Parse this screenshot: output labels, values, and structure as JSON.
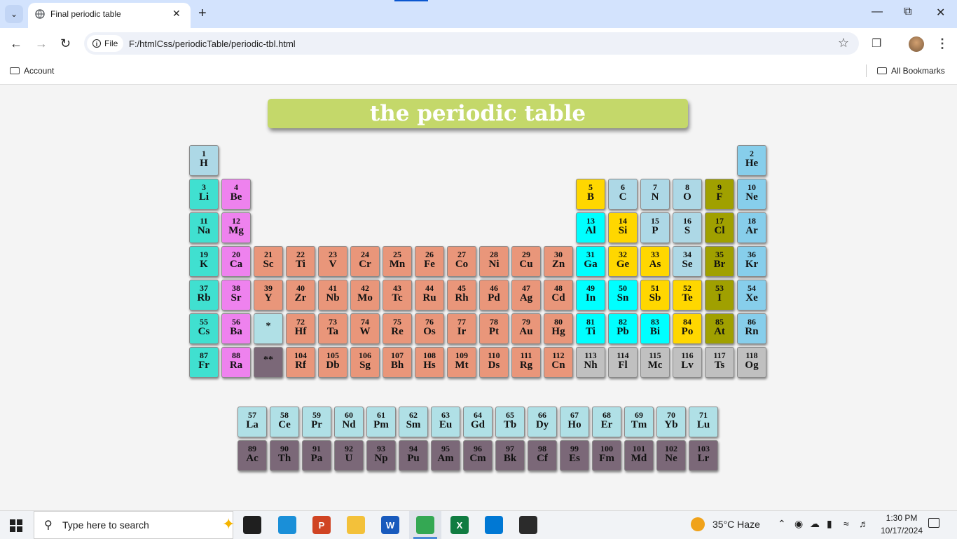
{
  "browser": {
    "tab_title": "Final periodic table",
    "url_chip": "File",
    "url": "F:/htmlCss/periodicTable/periodic-tbl.html",
    "bookmark_left": "Account",
    "bookmark_right": "All Bookmarks"
  },
  "page": {
    "title": "the periodic table",
    "colors": {
      "alkali": "#40e0d0",
      "alkaline": "#ee82ee",
      "transition": "#e9967a",
      "metalloid": "#ffd700",
      "post_transition": "#00ffff",
      "nonmetal": "#add8e6",
      "halogen": "#a0a000",
      "noble": "#87ceeb",
      "unknown": "#c0c0c0",
      "lanthanide": "#b0e0e6",
      "actinide": "#7b6878"
    },
    "elements": [
      {
        "n": "1",
        "s": "H",
        "row": 1,
        "col": 1,
        "c": "nonmetal"
      },
      {
        "n": "2",
        "s": "He",
        "row": 1,
        "col": 18,
        "c": "noble"
      },
      {
        "n": "3",
        "s": "Li",
        "row": 2,
        "col": 1,
        "c": "alkali"
      },
      {
        "n": "4",
        "s": "Be",
        "row": 2,
        "col": 2,
        "c": "alkaline"
      },
      {
        "n": "5",
        "s": "B",
        "row": 2,
        "col": 13,
        "c": "metalloid"
      },
      {
        "n": "6",
        "s": "C",
        "row": 2,
        "col": 14,
        "c": "nonmetal"
      },
      {
        "n": "7",
        "s": "N",
        "row": 2,
        "col": 15,
        "c": "nonmetal"
      },
      {
        "n": "8",
        "s": "O",
        "row": 2,
        "col": 16,
        "c": "nonmetal"
      },
      {
        "n": "9",
        "s": "F",
        "row": 2,
        "col": 17,
        "c": "halogen"
      },
      {
        "n": "10",
        "s": "Ne",
        "row": 2,
        "col": 18,
        "c": "noble"
      },
      {
        "n": "11",
        "s": "Na",
        "row": 3,
        "col": 1,
        "c": "alkali"
      },
      {
        "n": "12",
        "s": "Mg",
        "row": 3,
        "col": 2,
        "c": "alkaline"
      },
      {
        "n": "13",
        "s": "Al",
        "row": 3,
        "col": 13,
        "c": "post_transition"
      },
      {
        "n": "14",
        "s": "Si",
        "row": 3,
        "col": 14,
        "c": "metalloid"
      },
      {
        "n": "15",
        "s": "P",
        "row": 3,
        "col": 15,
        "c": "nonmetal"
      },
      {
        "n": "16",
        "s": "S",
        "row": 3,
        "col": 16,
        "c": "nonmetal"
      },
      {
        "n": "17",
        "s": "Cl",
        "row": 3,
        "col": 17,
        "c": "halogen"
      },
      {
        "n": "18",
        "s": "Ar",
        "row": 3,
        "col": 18,
        "c": "noble"
      },
      {
        "n": "19",
        "s": "K",
        "row": 4,
        "col": 1,
        "c": "alkali"
      },
      {
        "n": "20",
        "s": "Ca",
        "row": 4,
        "col": 2,
        "c": "alkaline"
      },
      {
        "n": "21",
        "s": "Sc",
        "row": 4,
        "col": 3,
        "c": "transition"
      },
      {
        "n": "22",
        "s": "Ti",
        "row": 4,
        "col": 4,
        "c": "transition"
      },
      {
        "n": "23",
        "s": "V",
        "row": 4,
        "col": 5,
        "c": "transition"
      },
      {
        "n": "24",
        "s": "Cr",
        "row": 4,
        "col": 6,
        "c": "transition"
      },
      {
        "n": "25",
        "s": "Mn",
        "row": 4,
        "col": 7,
        "c": "transition"
      },
      {
        "n": "26",
        "s": "Fe",
        "row": 4,
        "col": 8,
        "c": "transition"
      },
      {
        "n": "27",
        "s": "Co",
        "row": 4,
        "col": 9,
        "c": "transition"
      },
      {
        "n": "28",
        "s": "Ni",
        "row": 4,
        "col": 10,
        "c": "transition"
      },
      {
        "n": "29",
        "s": "Cu",
        "row": 4,
        "col": 11,
        "c": "transition"
      },
      {
        "n": "30",
        "s": "Zn",
        "row": 4,
        "col": 12,
        "c": "transition"
      },
      {
        "n": "31",
        "s": "Ga",
        "row": 4,
        "col": 13,
        "c": "post_transition"
      },
      {
        "n": "32",
        "s": "Ge",
        "row": 4,
        "col": 14,
        "c": "metalloid"
      },
      {
        "n": "33",
        "s": "As",
        "row": 4,
        "col": 15,
        "c": "metalloid"
      },
      {
        "n": "34",
        "s": "Se",
        "row": 4,
        "col": 16,
        "c": "nonmetal"
      },
      {
        "n": "35",
        "s": "Br",
        "row": 4,
        "col": 17,
        "c": "halogen"
      },
      {
        "n": "36",
        "s": "Kr",
        "row": 4,
        "col": 18,
        "c": "noble"
      },
      {
        "n": "37",
        "s": "Rb",
        "row": 5,
        "col": 1,
        "c": "alkali"
      },
      {
        "n": "38",
        "s": "Sr",
        "row": 5,
        "col": 2,
        "c": "alkaline"
      },
      {
        "n": "39",
        "s": "Y",
        "row": 5,
        "col": 3,
        "c": "transition"
      },
      {
        "n": "40",
        "s": "Zr",
        "row": 5,
        "col": 4,
        "c": "transition"
      },
      {
        "n": "41",
        "s": "Nb",
        "row": 5,
        "col": 5,
        "c": "transition"
      },
      {
        "n": "42",
        "s": "Mo",
        "row": 5,
        "col": 6,
        "c": "transition"
      },
      {
        "n": "43",
        "s": "Tc",
        "row": 5,
        "col": 7,
        "c": "transition"
      },
      {
        "n": "44",
        "s": "Ru",
        "row": 5,
        "col": 8,
        "c": "transition"
      },
      {
        "n": "45",
        "s": "Rh",
        "row": 5,
        "col": 9,
        "c": "transition"
      },
      {
        "n": "46",
        "s": "Pd",
        "row": 5,
        "col": 10,
        "c": "transition"
      },
      {
        "n": "47",
        "s": "Ag",
        "row": 5,
        "col": 11,
        "c": "transition"
      },
      {
        "n": "48",
        "s": "Cd",
        "row": 5,
        "col": 12,
        "c": "transition"
      },
      {
        "n": "49",
        "s": "In",
        "row": 5,
        "col": 13,
        "c": "post_transition"
      },
      {
        "n": "50",
        "s": "Sn",
        "row": 5,
        "col": 14,
        "c": "post_transition"
      },
      {
        "n": "51",
        "s": "Sb",
        "row": 5,
        "col": 15,
        "c": "metalloid"
      },
      {
        "n": "52",
        "s": "Te",
        "row": 5,
        "col": 16,
        "c": "metalloid"
      },
      {
        "n": "53",
        "s": "I",
        "row": 5,
        "col": 17,
        "c": "halogen"
      },
      {
        "n": "54",
        "s": "Xe",
        "row": 5,
        "col": 18,
        "c": "noble"
      },
      {
        "n": "55",
        "s": "Cs",
        "row": 6,
        "col": 1,
        "c": "alkali"
      },
      {
        "n": "56",
        "s": "Ba",
        "row": 6,
        "col": 2,
        "c": "alkaline"
      },
      {
        "n": "",
        "s": "*",
        "row": 6,
        "col": 3,
        "c": "lanthanide",
        "star": true
      },
      {
        "n": "72",
        "s": "Hf",
        "row": 6,
        "col": 4,
        "c": "transition"
      },
      {
        "n": "73",
        "s": "Ta",
        "row": 6,
        "col": 5,
        "c": "transition"
      },
      {
        "n": "74",
        "s": "W",
        "row": 6,
        "col": 6,
        "c": "transition"
      },
      {
        "n": "75",
        "s": "Re",
        "row": 6,
        "col": 7,
        "c": "transition"
      },
      {
        "n": "76",
        "s": "Os",
        "row": 6,
        "col": 8,
        "c": "transition"
      },
      {
        "n": "77",
        "s": "Ir",
        "row": 6,
        "col": 9,
        "c": "transition"
      },
      {
        "n": "78",
        "s": "Pt",
        "row": 6,
        "col": 10,
        "c": "transition"
      },
      {
        "n": "79",
        "s": "Au",
        "row": 6,
        "col": 11,
        "c": "transition"
      },
      {
        "n": "80",
        "s": "Hg",
        "row": 6,
        "col": 12,
        "c": "transition"
      },
      {
        "n": "81",
        "s": "Ti",
        "row": 6,
        "col": 13,
        "c": "post_transition"
      },
      {
        "n": "82",
        "s": "Pb",
        "row": 6,
        "col": 14,
        "c": "post_transition"
      },
      {
        "n": "83",
        "s": "Bi",
        "row": 6,
        "col": 15,
        "c": "post_transition"
      },
      {
        "n": "84",
        "s": "Po",
        "row": 6,
        "col": 16,
        "c": "metalloid"
      },
      {
        "n": "85",
        "s": "At",
        "row": 6,
        "col": 17,
        "c": "halogen"
      },
      {
        "n": "86",
        "s": "Rn",
        "row": 6,
        "col": 18,
        "c": "noble"
      },
      {
        "n": "87",
        "s": "Fr",
        "row": 7,
        "col": 1,
        "c": "alkali"
      },
      {
        "n": "88",
        "s": "Ra",
        "row": 7,
        "col": 2,
        "c": "alkaline"
      },
      {
        "n": "",
        "s": "**",
        "row": 7,
        "col": 3,
        "c": "actinide",
        "star": true
      },
      {
        "n": "104",
        "s": "Rf",
        "row": 7,
        "col": 4,
        "c": "transition"
      },
      {
        "n": "105",
        "s": "Db",
        "row": 7,
        "col": 5,
        "c": "transition"
      },
      {
        "n": "106",
        "s": "Sg",
        "row": 7,
        "col": 6,
        "c": "transition"
      },
      {
        "n": "107",
        "s": "Bh",
        "row": 7,
        "col": 7,
        "c": "transition"
      },
      {
        "n": "108",
        "s": "Hs",
        "row": 7,
        "col": 8,
        "c": "transition"
      },
      {
        "n": "109",
        "s": "Mt",
        "row": 7,
        "col": 9,
        "c": "transition"
      },
      {
        "n": "110",
        "s": "Ds",
        "row": 7,
        "col": 10,
        "c": "transition"
      },
      {
        "n": "111",
        "s": "Rg",
        "row": 7,
        "col": 11,
        "c": "transition"
      },
      {
        "n": "112",
        "s": "Cn",
        "row": 7,
        "col": 12,
        "c": "transition"
      },
      {
        "n": "113",
        "s": "Nh",
        "row": 7,
        "col": 13,
        "c": "unknown"
      },
      {
        "n": "114",
        "s": "Fl",
        "row": 7,
        "col": 14,
        "c": "unknown"
      },
      {
        "n": "115",
        "s": "Mc",
        "row": 7,
        "col": 15,
        "c": "unknown"
      },
      {
        "n": "116",
        "s": "Lv",
        "row": 7,
        "col": 16,
        "c": "unknown"
      },
      {
        "n": "117",
        "s": "Ts",
        "row": 7,
        "col": 17,
        "c": "unknown"
      },
      {
        "n": "118",
        "s": "Og",
        "row": 7,
        "col": 18,
        "c": "unknown"
      }
    ],
    "lanthanides": [
      {
        "n": "57",
        "s": "La"
      },
      {
        "n": "58",
        "s": "Ce"
      },
      {
        "n": "59",
        "s": "Pr"
      },
      {
        "n": "60",
        "s": "Nd"
      },
      {
        "n": "61",
        "s": "Pm"
      },
      {
        "n": "62",
        "s": "Sm"
      },
      {
        "n": "63",
        "s": "Eu"
      },
      {
        "n": "64",
        "s": "Gd"
      },
      {
        "n": "65",
        "s": "Tb"
      },
      {
        "n": "66",
        "s": "Dy"
      },
      {
        "n": "67",
        "s": "Ho"
      },
      {
        "n": "68",
        "s": "Er"
      },
      {
        "n": "69",
        "s": "Tm"
      },
      {
        "n": "70",
        "s": "Yb"
      },
      {
        "n": "71",
        "s": "Lu"
      }
    ],
    "actinides": [
      {
        "n": "89",
        "s": "Ac"
      },
      {
        "n": "90",
        "s": "Th"
      },
      {
        "n": "91",
        "s": "Pa"
      },
      {
        "n": "92",
        "s": "U"
      },
      {
        "n": "93",
        "s": "Np"
      },
      {
        "n": "94",
        "s": "Pu"
      },
      {
        "n": "95",
        "s": "Am"
      },
      {
        "n": "96",
        "s": "Cm"
      },
      {
        "n": "97",
        "s": "Bk"
      },
      {
        "n": "98",
        "s": "Cf"
      },
      {
        "n": "99",
        "s": "Es"
      },
      {
        "n": "100",
        "s": "Fm"
      },
      {
        "n": "101",
        "s": "Md"
      },
      {
        "n": "102",
        "s": "Ne"
      },
      {
        "n": "103",
        "s": "Lr"
      }
    ]
  },
  "taskbar": {
    "search_placeholder": "Type here to search",
    "weather": "35°C  Haze",
    "time": "1:30 PM",
    "date": "10/17/2024",
    "apps": [
      {
        "name": "task-view",
        "label": "",
        "color": "#1f1f1f"
      },
      {
        "name": "edge",
        "label": "",
        "color": "#1a8fd8"
      },
      {
        "name": "powerpoint",
        "label": "P",
        "color": "#d04423"
      },
      {
        "name": "file-explorer",
        "label": "",
        "color": "#f3c13a"
      },
      {
        "name": "word",
        "label": "W",
        "color": "#185abd"
      },
      {
        "name": "chrome",
        "label": "",
        "color": "#34a853"
      },
      {
        "name": "excel",
        "label": "X",
        "color": "#107c41"
      },
      {
        "name": "vscode",
        "label": "",
        "color": "#0078d4"
      },
      {
        "name": "terminal",
        "label": "",
        "color": "#2b2b2b"
      }
    ]
  }
}
